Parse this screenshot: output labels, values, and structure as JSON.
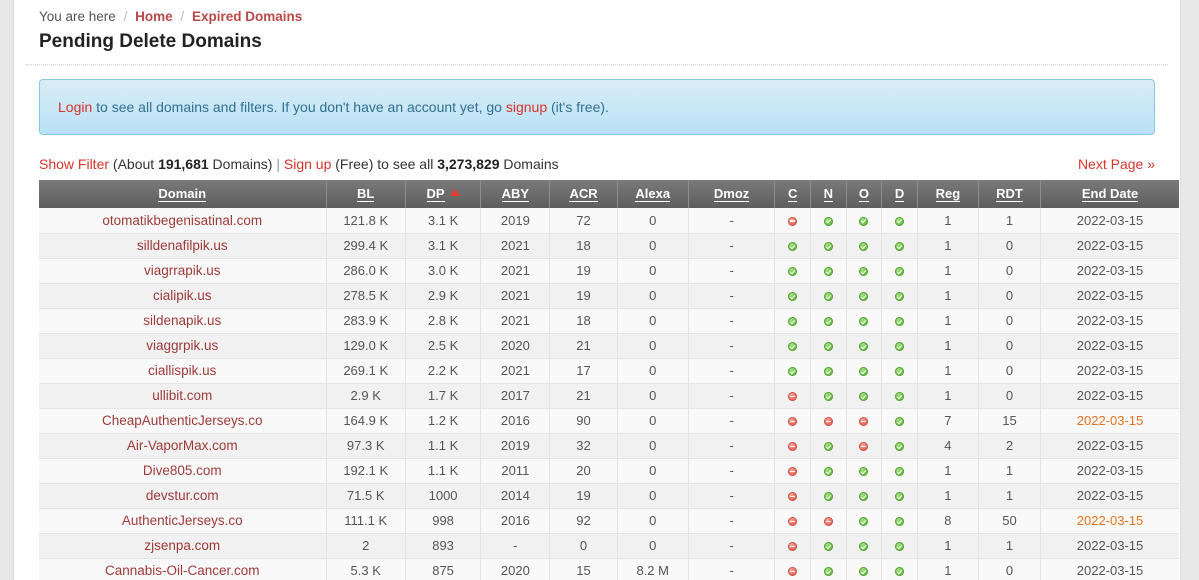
{
  "breadcrumb": {
    "prefix": "You are here",
    "items": [
      {
        "label": "Home"
      },
      {
        "label": "Expired Domains"
      }
    ]
  },
  "page_title": "Pending Delete Domains",
  "alert": {
    "login_label": "Login",
    "text_mid": " to see all domains and filters. If you don't have an account yet, go ",
    "signup_label": "signup",
    "text_end": " (it's free)."
  },
  "filterbar": {
    "show_filter_label": "Show Filter",
    "about_prefix": " (About ",
    "domain_count": "191,681",
    "domains_word": " Domains) ",
    "separator": "| ",
    "signup_label": "Sign up",
    "free_text": " (Free) to see all ",
    "total_count": "3,273,829",
    "total_suffix": " Domains",
    "next_page_label": "Next Page »"
  },
  "table": {
    "columns": [
      {
        "key": "domain",
        "label": "Domain",
        "sorted": false
      },
      {
        "key": "bl",
        "label": "BL",
        "sorted": false
      },
      {
        "key": "dp",
        "label": "DP",
        "sorted": true,
        "sort_dir": "asc"
      },
      {
        "key": "aby",
        "label": "ABY",
        "sorted": false
      },
      {
        "key": "acr",
        "label": "ACR",
        "sorted": false
      },
      {
        "key": "alexa",
        "label": "Alexa",
        "sorted": false
      },
      {
        "key": "dmoz",
        "label": "Dmoz",
        "sorted": false
      },
      {
        "key": "c",
        "label": "C",
        "sorted": false
      },
      {
        "key": "n",
        "label": "N",
        "sorted": false
      },
      {
        "key": "o",
        "label": "O",
        "sorted": false
      },
      {
        "key": "d",
        "label": "D",
        "sorted": false
      },
      {
        "key": "reg",
        "label": "Reg",
        "sorted": false
      },
      {
        "key": "rdt",
        "label": "RDT",
        "sorted": false
      },
      {
        "key": "end_date",
        "label": "End Date",
        "sorted": false
      }
    ],
    "rows": [
      {
        "domain": "otomatikbegenisatinal.com",
        "bl": "121.8 K",
        "dp": "3.1 K",
        "aby": "2019",
        "acr": "72",
        "alexa": "0",
        "dmoz": "-",
        "c": "bad",
        "n": "ok",
        "o": "ok",
        "d": "ok",
        "reg": "1",
        "rdt": "1",
        "end_date": "2022-03-15",
        "date_state": "normal"
      },
      {
        "domain": "silldenafilpik.us",
        "bl": "299.4 K",
        "dp": "3.1 K",
        "aby": "2021",
        "acr": "18",
        "alexa": "0",
        "dmoz": "-",
        "c": "ok",
        "n": "ok",
        "o": "ok",
        "d": "ok",
        "reg": "1",
        "rdt": "0",
        "end_date": "2022-03-15",
        "date_state": "normal"
      },
      {
        "domain": "viagrrapik.us",
        "bl": "286.0 K",
        "dp": "3.0 K",
        "aby": "2021",
        "acr": "19",
        "alexa": "0",
        "dmoz": "-",
        "c": "ok",
        "n": "ok",
        "o": "ok",
        "d": "ok",
        "reg": "1",
        "rdt": "0",
        "end_date": "2022-03-15",
        "date_state": "normal"
      },
      {
        "domain": "cialipik.us",
        "bl": "278.5 K",
        "dp": "2.9 K",
        "aby": "2021",
        "acr": "19",
        "alexa": "0",
        "dmoz": "-",
        "c": "ok",
        "n": "ok",
        "o": "ok",
        "d": "ok",
        "reg": "1",
        "rdt": "0",
        "end_date": "2022-03-15",
        "date_state": "normal"
      },
      {
        "domain": "sildenapik.us",
        "bl": "283.9 K",
        "dp": "2.8 K",
        "aby": "2021",
        "acr": "18",
        "alexa": "0",
        "dmoz": "-",
        "c": "ok",
        "n": "ok",
        "o": "ok",
        "d": "ok",
        "reg": "1",
        "rdt": "0",
        "end_date": "2022-03-15",
        "date_state": "normal"
      },
      {
        "domain": "viaggrpik.us",
        "bl": "129.0 K",
        "dp": "2.5 K",
        "aby": "2020",
        "acr": "21",
        "alexa": "0",
        "dmoz": "-",
        "c": "ok",
        "n": "ok",
        "o": "ok",
        "d": "ok",
        "reg": "1",
        "rdt": "0",
        "end_date": "2022-03-15",
        "date_state": "normal"
      },
      {
        "domain": "ciallispik.us",
        "bl": "269.1 K",
        "dp": "2.2 K",
        "aby": "2021",
        "acr": "17",
        "alexa": "0",
        "dmoz": "-",
        "c": "ok",
        "n": "ok",
        "o": "ok",
        "d": "ok",
        "reg": "1",
        "rdt": "0",
        "end_date": "2022-03-15",
        "date_state": "normal"
      },
      {
        "domain": "ullibit.com",
        "bl": "2.9 K",
        "dp": "1.7 K",
        "aby": "2017",
        "acr": "21",
        "alexa": "0",
        "dmoz": "-",
        "c": "bad",
        "n": "ok",
        "o": "ok",
        "d": "ok",
        "reg": "1",
        "rdt": "0",
        "end_date": "2022-03-15",
        "date_state": "normal"
      },
      {
        "domain": "CheapAuthenticJerseys.co",
        "bl": "164.9 K",
        "dp": "1.2 K",
        "aby": "2016",
        "acr": "90",
        "alexa": "0",
        "dmoz": "-",
        "c": "bad",
        "n": "bad",
        "o": "bad",
        "d": "ok",
        "reg": "7",
        "rdt": "15",
        "end_date": "2022-03-15",
        "date_state": "warn"
      },
      {
        "domain": "Air-VaporMax.com",
        "bl": "97.3 K",
        "dp": "1.1 K",
        "aby": "2019",
        "acr": "32",
        "alexa": "0",
        "dmoz": "-",
        "c": "bad",
        "n": "ok",
        "o": "bad",
        "d": "ok",
        "reg": "4",
        "rdt": "2",
        "end_date": "2022-03-15",
        "date_state": "normal"
      },
      {
        "domain": "Dive805.com",
        "bl": "192.1 K",
        "dp": "1.1 K",
        "aby": "2011",
        "acr": "20",
        "alexa": "0",
        "dmoz": "-",
        "c": "bad",
        "n": "ok",
        "o": "ok",
        "d": "ok",
        "reg": "1",
        "rdt": "1",
        "end_date": "2022-03-15",
        "date_state": "normal"
      },
      {
        "domain": "devstur.com",
        "bl": "71.5 K",
        "dp": "1000",
        "aby": "2014",
        "acr": "19",
        "alexa": "0",
        "dmoz": "-",
        "c": "bad",
        "n": "ok",
        "o": "ok",
        "d": "ok",
        "reg": "1",
        "rdt": "1",
        "end_date": "2022-03-15",
        "date_state": "normal"
      },
      {
        "domain": "AuthenticJerseys.co",
        "bl": "111.1 K",
        "dp": "998",
        "aby": "2016",
        "acr": "92",
        "alexa": "0",
        "dmoz": "-",
        "c": "bad",
        "n": "bad",
        "o": "ok",
        "d": "ok",
        "reg": "8",
        "rdt": "50",
        "end_date": "2022-03-15",
        "date_state": "warn"
      },
      {
        "domain": "zjsenpa.com",
        "bl": "2",
        "dp": "893",
        "aby": "-",
        "acr": "0",
        "alexa": "0",
        "dmoz": "-",
        "c": "bad",
        "n": "ok",
        "o": "ok",
        "d": "ok",
        "reg": "1",
        "rdt": "1",
        "end_date": "2022-03-15",
        "date_state": "normal"
      },
      {
        "domain": "Cannabis-Oil-Cancer.com",
        "bl": "5.3 K",
        "dp": "875",
        "aby": "2020",
        "acr": "15",
        "alexa": "8.2 M",
        "dmoz": "-",
        "c": "bad",
        "n": "ok",
        "o": "ok",
        "d": "ok",
        "reg": "1",
        "rdt": "0",
        "end_date": "2022-03-15",
        "date_state": "normal"
      }
    ]
  },
  "colors": {
    "link_red": "#d9342b",
    "domain_red": "#9e3a38",
    "date_green": "#2e8b2e",
    "date_orange": "#e8721c",
    "header_gray": "#6b6b6b",
    "alert_bg": "#b9e1f5",
    "alert_text": "#31708f"
  }
}
